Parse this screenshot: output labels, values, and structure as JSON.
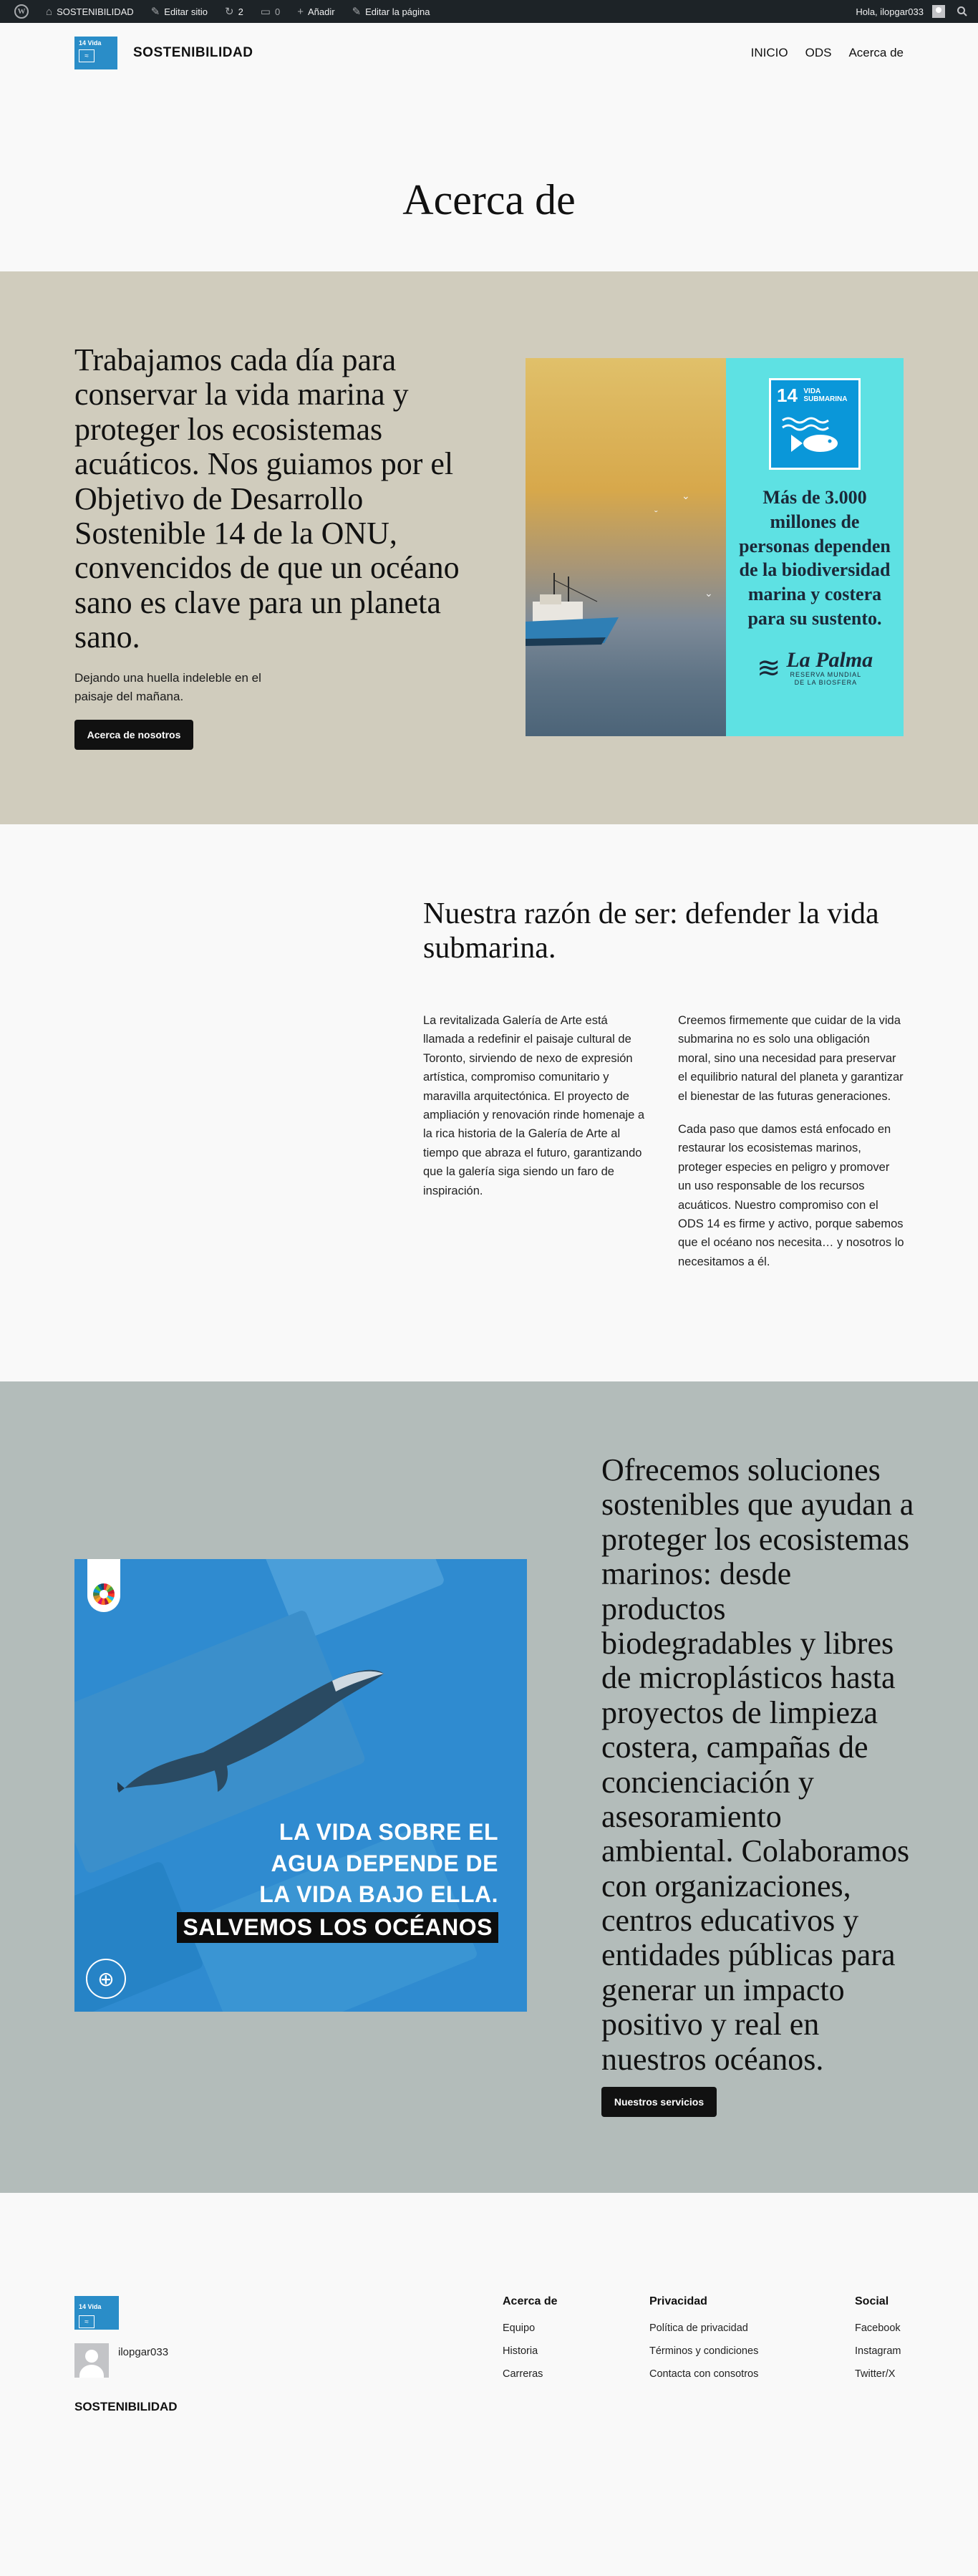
{
  "admin_bar": {
    "site_name": "SOSTENIBILIDAD",
    "edit_site": "Editar sitio",
    "updates_count": "2",
    "comments_count": "0",
    "add_new": "Añadir",
    "edit_page": "Editar la página",
    "greeting": "Hola, ilopgar033"
  },
  "header": {
    "logo_number": "14 Vida",
    "site_title": "SOSTENIBILIDAD",
    "nav": [
      "INICIO",
      "ODS",
      "Acerca de"
    ]
  },
  "page_title": "Acerca de",
  "hero": {
    "heading": "Trabajamos cada día para conservar la vida marina y proteger los ecosistemas acuáticos. Nos guiamos por el Objetivo de Desarrollo Sostenible 14 de la ONU, convencidos de que un océano sano es clave para un planeta sano.",
    "subtext": "Dejando una huella indeleble en el paisaje del mañana.",
    "button": "Acerca de nosotros",
    "image": {
      "sdg_number": "14",
      "sdg_title": "VIDA SUBMARINA",
      "stat": "Más de 3.000 millones de personas dependen de la biodiversidad marina y costera para su sustento.",
      "brand_name": "La Palma",
      "brand_tagline": "RESERVA MUNDIAL DE LA BIOSFERA"
    }
  },
  "reason": {
    "heading": "Nuestra razón de ser: defender la vida submarina.",
    "col_a": "La revitalizada Galería de Arte está llamada a redefinir el paisaje cultural de Toronto, sirviendo de nexo de expresión artística, compromiso comunitario y maravilla arquitectónica. El proyecto de ampliación y renovación rinde homenaje a la rica historia de la Galería de Arte al tiempo que abraza el futuro, garantizando que la galería siga siendo un faro de inspiración.",
    "col_b_1": "Creemos firmemente que cuidar de la vida submarina no es solo una obligación moral, sino una necesidad para preservar el equilibrio natural del planeta y garantizar el bienestar de las futuras generaciones.",
    "col_b_2": "Cada paso que damos está enfocado en restaurar los ecosistemas marinos, proteger especies en peligro y promover un uso responsable de los recursos acuáticos. Nuestro compromiso con el ODS 14 es firme y activo, porque sabemos que el océano nos necesita… y nosotros lo necesitamos a él."
  },
  "solutions": {
    "heading": "Ofrecemos soluciones sostenibles que ayudan a proteger los ecosistemas marinos: desde productos biodegradables y libres de microplásticos hasta proyectos de limpieza costera, campañas de concienciación y asesoramiento ambiental. Colaboramos con organizaciones, centros educativos y entidades públicas para generar un impacto positivo y real en nuestros océanos.",
    "button": "Nuestros servicios",
    "image": {
      "line1": "LA VIDA SOBRE EL",
      "line2": "AGUA DEPENDE DE",
      "line3": "LA VIDA BAJO ELLA.",
      "line4": "SALVEMOS LOS OCÉANOS"
    }
  },
  "footer": {
    "username": "ilopgar033",
    "site_title": "SOSTENIBILIDAD",
    "columns": [
      {
        "title": "Acerca de",
        "links": [
          "Equipo",
          "Historia",
          "Carreras"
        ]
      },
      {
        "title": "Privacidad",
        "links": [
          "Política de privacidad",
          "Términos y condiciones",
          "Contacta con consotros"
        ]
      },
      {
        "title": "Social",
        "links": [
          "Facebook",
          "Instagram",
          "Twitter/X"
        ]
      }
    ]
  },
  "colors": {
    "admin_bar": "#1d2327",
    "hero_bg": "#d0ccbd",
    "solutions_bg": "#b3bcba",
    "sdg14_blue": "#0a97d9",
    "card_cyan": "#5ee1e3",
    "button": "#111111"
  },
  "icons": {
    "wordpress": "wordpress-logo-icon",
    "edit_site": "brush-icon",
    "updates": "updates-icon",
    "comments": "comment-icon",
    "add": "plus-icon",
    "edit": "pencil-icon",
    "search": "search-icon"
  }
}
